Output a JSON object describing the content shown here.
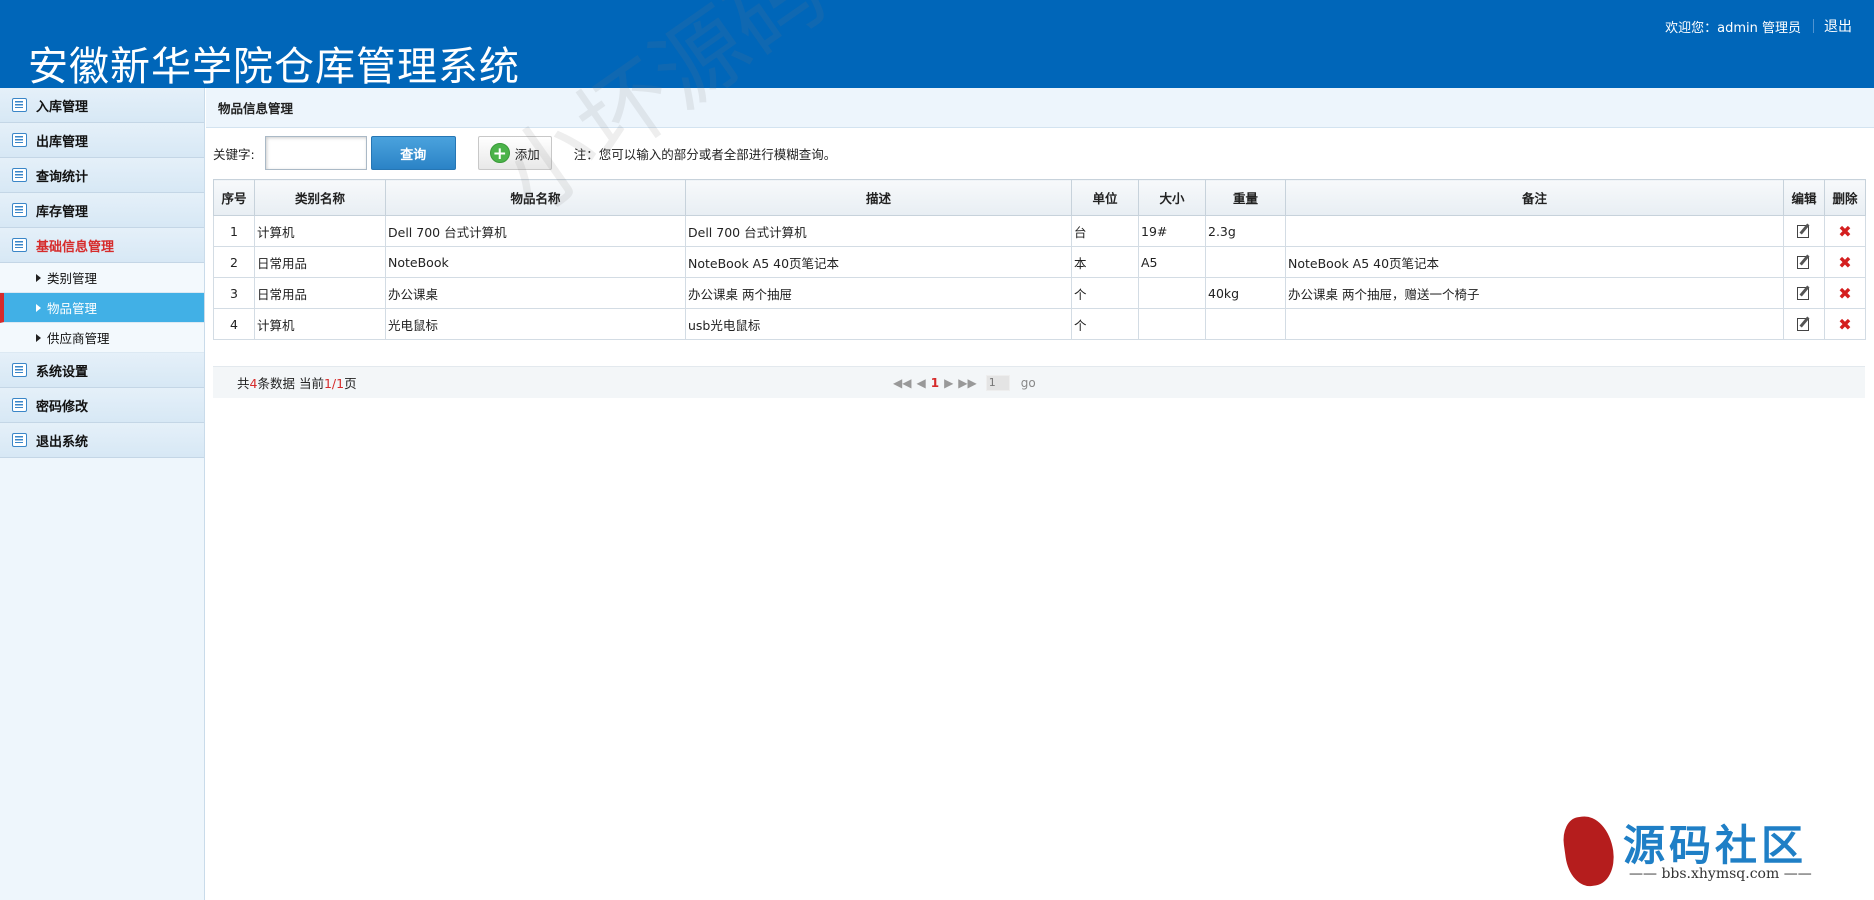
{
  "header": {
    "title": "安徽新华学院仓库管理系统",
    "welcome": "欢迎您：admin 管理员",
    "logout": "退出"
  },
  "sidebar": {
    "items": [
      {
        "label": "入库管理"
      },
      {
        "label": "出库管理"
      },
      {
        "label": "查询统计"
      },
      {
        "label": "库存管理"
      },
      {
        "label": "基础信息管理"
      },
      {
        "label": "系统设置"
      },
      {
        "label": "密码修改"
      },
      {
        "label": "退出系统"
      }
    ],
    "sub_items": [
      {
        "label": "类别管理"
      },
      {
        "label": "物品管理"
      },
      {
        "label": "供应商管理"
      }
    ]
  },
  "page": {
    "heading": "物品信息管理",
    "search_label": "关键字:",
    "search_value": "",
    "query_button": "查询",
    "add_button": "添加",
    "hint": "注：您可以输入的部分或者全部进行模糊查询。"
  },
  "table": {
    "headers": [
      "序号",
      "类别名称",
      "物品名称",
      "描述",
      "单位",
      "大小",
      "重量",
      "备注",
      "编辑",
      "删除"
    ],
    "rows": [
      {
        "no": "1",
        "category": "计算机",
        "name": "Dell 700 台式计算机",
        "desc": "Dell 700 台式计算机",
        "unit": "台",
        "size": "19#",
        "weight": "2.3g",
        "remark": ""
      },
      {
        "no": "2",
        "category": "日常用品",
        "name": "NoteBook",
        "desc": "NoteBook A5 40页笔记本",
        "unit": "本",
        "size": "A5",
        "weight": "",
        "remark": "NoteBook A5 40页笔记本"
      },
      {
        "no": "3",
        "category": "日常用品",
        "name": "办公课桌",
        "desc": "办公课桌 两个抽屉",
        "unit": "个",
        "size": "",
        "weight": "40kg",
        "remark": "办公课桌 两个抽屉，赠送一个椅子"
      },
      {
        "no": "4",
        "category": "计算机",
        "name": "光电鼠标",
        "desc": "usb光电鼠标",
        "unit": "个",
        "size": "",
        "weight": "",
        "remark": ""
      }
    ]
  },
  "pager": {
    "prefix": "共",
    "total": "4",
    "middle": "条数据 当前",
    "current": "1",
    "slash": "/",
    "pages": "1",
    "suffix": "页",
    "current_page": "1",
    "page_input": "1",
    "go": "go"
  },
  "watermark": "小坏源码",
  "logo": {
    "text": "源码社区",
    "url": "—— bbs.xhymsq.com ——"
  },
  "colors": {
    "header_bg": "#0066b9",
    "accent_red": "#d62b2b",
    "selected_bg": "#41b0e6"
  }
}
